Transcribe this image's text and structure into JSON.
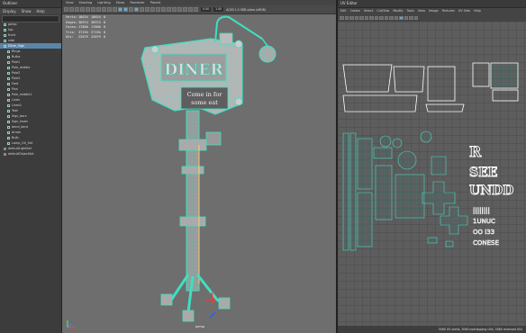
{
  "outliner": {
    "title": "Outliner",
    "menu": [
      "Display",
      "Show",
      "Help"
    ],
    "items": [
      {
        "label": "persp",
        "level": 0,
        "type": "camera"
      },
      {
        "label": "top",
        "level": 0,
        "type": "camera"
      },
      {
        "label": "front",
        "level": 0,
        "type": "camera"
      },
      {
        "label": "side",
        "level": 0,
        "type": "camera"
      },
      {
        "label": "Diner_Sign",
        "level": 0,
        "type": "group",
        "selected": true
      },
      {
        "label": "Rings",
        "level": 1,
        "type": "mesh"
      },
      {
        "label": "Bulbs",
        "level": 1,
        "type": "mesh"
      },
      {
        "label": "Pole1",
        "level": 1,
        "type": "mesh"
      },
      {
        "label": "Pole_middle",
        "level": 1,
        "type": "mesh"
      },
      {
        "label": "Pole2",
        "level": 1,
        "type": "mesh"
      },
      {
        "label": "Pole3",
        "level": 1,
        "type": "mesh"
      },
      {
        "label": "Feet",
        "level": 1,
        "type": "mesh"
      },
      {
        "label": "Pins",
        "level": 1,
        "type": "mesh"
      },
      {
        "label": "Pole_middle1",
        "level": 1,
        "type": "mesh"
      },
      {
        "label": "Lines",
        "level": 1,
        "type": "mesh"
      },
      {
        "label": "Lines1",
        "level": 1,
        "type": "mesh"
      },
      {
        "label": "Text",
        "level": 1,
        "type": "mesh"
      },
      {
        "label": "Sign_bars",
        "level": 1,
        "type": "mesh"
      },
      {
        "label": "Sign_head",
        "level": 1,
        "type": "mesh"
      },
      {
        "label": "bend_bent",
        "level": 1,
        "type": "mesh"
      },
      {
        "label": "Arrow",
        "level": 1,
        "type": "mesh"
      },
      {
        "label": "Bulb",
        "level": 1,
        "type": "mesh"
      },
      {
        "label": "Lamp_UV_Set",
        "level": 1,
        "type": "mesh"
      },
      {
        "label": "defaultLightSet",
        "level": 0,
        "type": "set"
      },
      {
        "label": "defaultObjectSet",
        "level": 0,
        "type": "set"
      }
    ]
  },
  "viewport": {
    "menu": [
      "View",
      "Shading",
      "Lighting",
      "Show",
      "Renderer",
      "Panels"
    ],
    "zoom_field": "0.00",
    "scale_field": "1.00",
    "color_space": "ACES 1.0 SDR-video (sRGB)",
    "hud": {
      "headers": [
        "",
        "",
        "",
        ""
      ],
      "rows": [
        {
          "label": "Verts:",
          "a": "18624",
          "b": "18624",
          "c": "0"
        },
        {
          "label": "Edges:",
          "a": "36974",
          "b": "36974",
          "c": "0"
        },
        {
          "label": "Faces:",
          "a": "17800",
          "b": "17800",
          "c": "0"
        },
        {
          "label": "Tris:",
          "a": "37194",
          "b": "37194",
          "c": "0"
        },
        {
          "label": "UVs:",
          "a": "23079",
          "b": "23079",
          "c": "0"
        }
      ]
    },
    "camera_label": "persp",
    "sign_text_top": "DINER",
    "sign_text_bottom_1": "Come in for",
    "sign_text_bottom_2": "some eat"
  },
  "uveditor": {
    "title": "UV Editor",
    "menu": [
      "Edit",
      "Create",
      "Select",
      "Cut/Sew",
      "Modify",
      "Tools",
      "View",
      "Image",
      "Textures",
      "UV Sets",
      "Help"
    ],
    "status": "3060 UV shells, 3060 overlapping UVs, 3060 reversed UVs"
  },
  "colors": {
    "wire": "#3ee0c0",
    "wire_dark": "#1aa08a",
    "mesh": "#c9c9c9",
    "uv_shell": "#4fd8c4",
    "uv_outline": "#ffffff",
    "selection_blue": "#5a85a8"
  }
}
